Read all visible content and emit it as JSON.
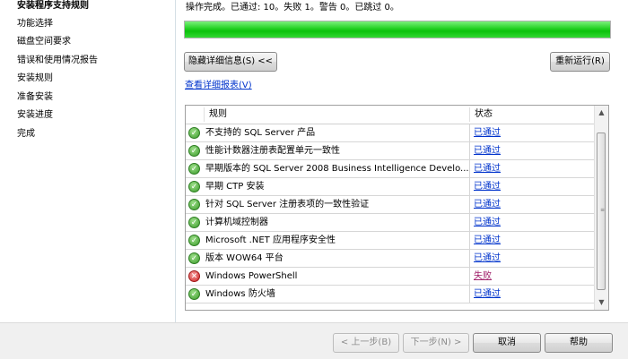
{
  "sidebar": {
    "items": [
      {
        "label": "安装程序支持规则",
        "active": true
      },
      {
        "label": "功能选择"
      },
      {
        "label": "磁盘空间要求"
      },
      {
        "label": "错误和使用情况报告"
      },
      {
        "label": "安装规则"
      },
      {
        "label": "准备安装"
      },
      {
        "label": "安装进度"
      },
      {
        "label": "完成"
      }
    ]
  },
  "main": {
    "status_text": "操作完成。已通过: 10。失败 1。警告 0。已跳过 0。",
    "progress": 1.0,
    "hide_details_label": "隐藏详细信息(S) <<",
    "rerun_label": "重新运行(R)",
    "report_link": "查看详细报表(V)",
    "columns": {
      "rule": "规则",
      "status": "状态"
    },
    "rules": [
      {
        "name": "不支持的 SQL Server 产品",
        "status": "已通过",
        "result": "pass"
      },
      {
        "name": "性能计数器注册表配置单元一致性",
        "status": "已通过",
        "result": "pass"
      },
      {
        "name": "早期版本的 SQL Server 2008 Business Intelligence Develo...",
        "status": "已通过",
        "result": "pass"
      },
      {
        "name": "早期 CTP 安装",
        "status": "已通过",
        "result": "pass"
      },
      {
        "name": "针对 SQL Server 注册表项的一致性验证",
        "status": "已通过",
        "result": "pass"
      },
      {
        "name": "计算机域控制器",
        "status": "已通过",
        "result": "pass"
      },
      {
        "name": "Microsoft .NET 应用程序安全性",
        "status": "已通过",
        "result": "pass"
      },
      {
        "name": "版本 WOW64 平台",
        "status": "已通过",
        "result": "pass"
      },
      {
        "name": "Windows PowerShell",
        "status": "失败",
        "result": "fail"
      },
      {
        "name": "Windows 防火墙",
        "status": "已通过",
        "result": "pass"
      }
    ]
  },
  "footer": {
    "back_label": "< 上一步(B)",
    "next_label": "下一步(N) >",
    "cancel_label": "取消",
    "help_label": "帮助"
  },
  "colors": {
    "progress_green": "#0cc20c",
    "link_blue": "#0033cc",
    "fail_status": "#a0206a"
  }
}
